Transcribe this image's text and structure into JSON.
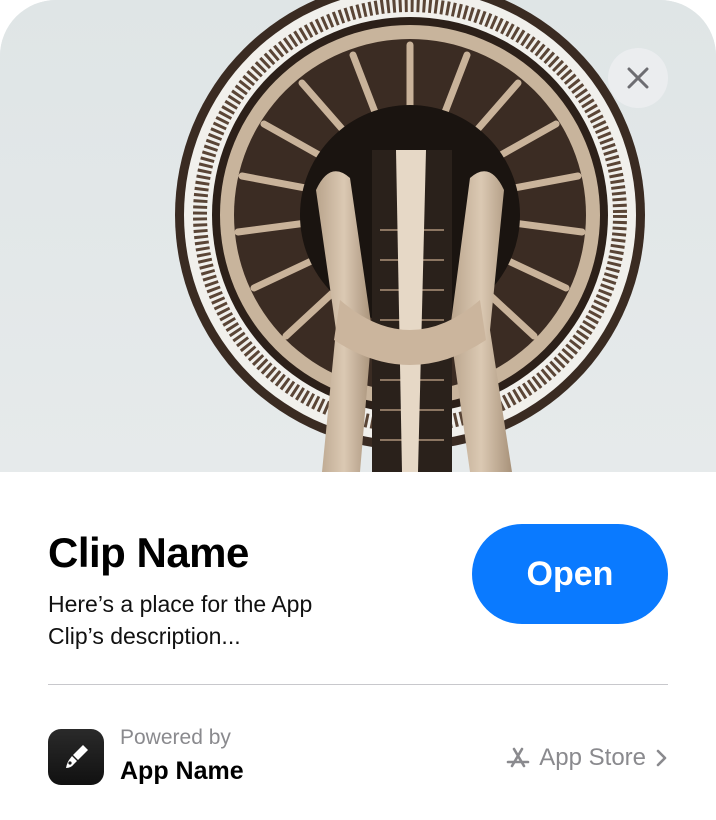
{
  "hero": {
    "image_alt": "Space Needle viewed from below",
    "close_icon": "close-icon"
  },
  "clip": {
    "title": "Clip Name",
    "description": "Here’s a place for the App Clip’s description...",
    "open_label": "Open"
  },
  "footer": {
    "powered_by": "Powered by",
    "app_name": "App Name",
    "app_icon": "paintbrush-icon",
    "app_store_label": "App Store",
    "app_store_icon": "app-store-icon",
    "chevron_icon": "chevron-right-icon"
  },
  "colors": {
    "accent": "#0a7aff",
    "secondary_text": "#8a8a8e",
    "sky": "#e2e7e8"
  }
}
